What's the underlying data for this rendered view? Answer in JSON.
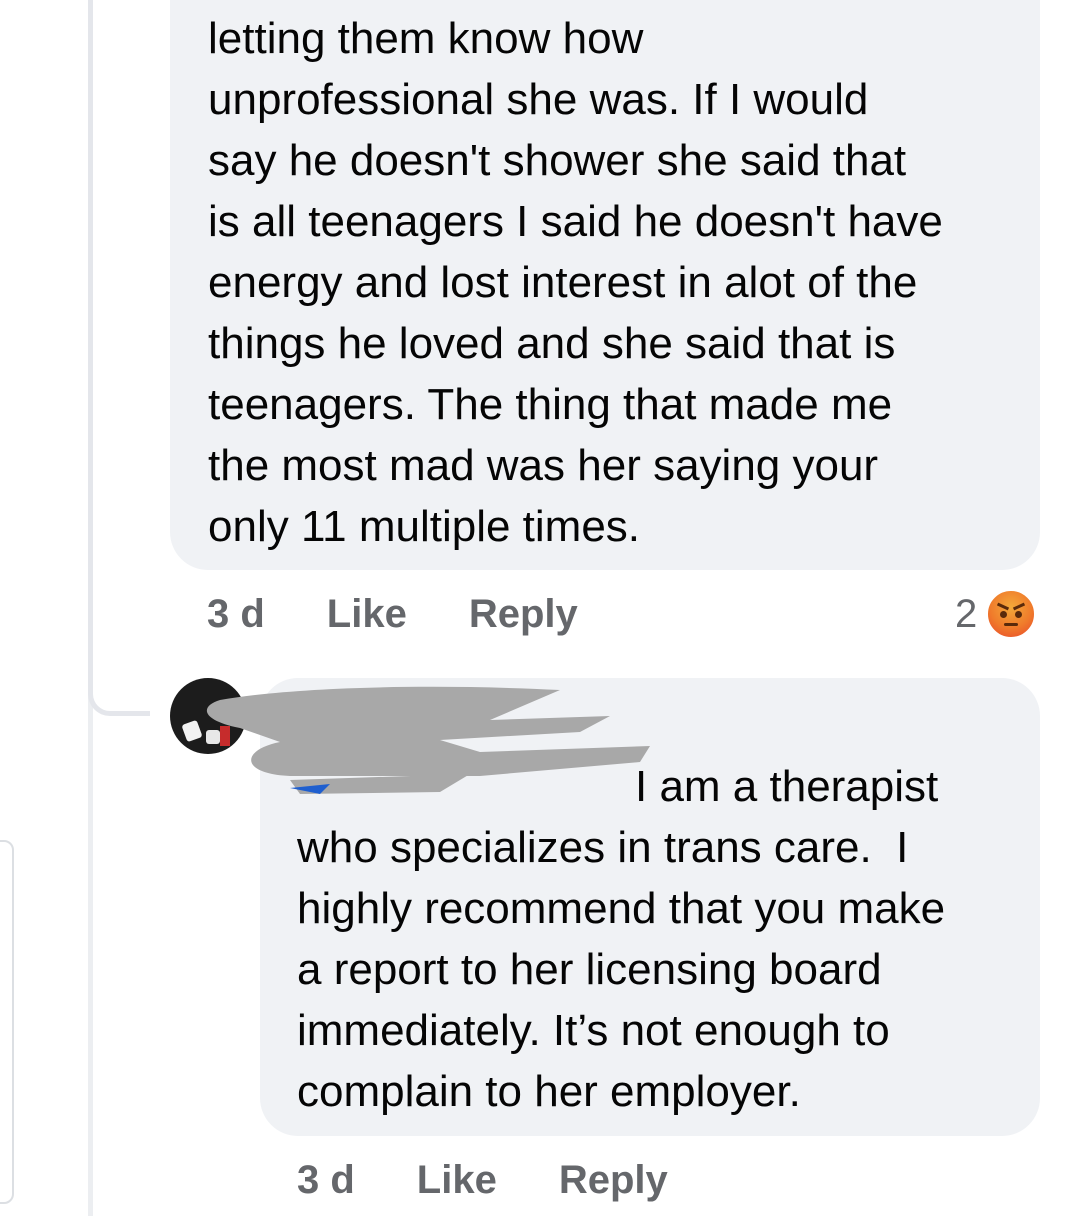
{
  "comments": [
    {
      "text": "letting them know how\nunprofessional she was. If I would\nsay he doesn't shower she said that\nis all teenagers I said he doesn't have\nenergy and lost interest in alot of the\nthings he loved and she said that is\nteenagers. The thing that made me\nthe most mad was her saying your\nonly 11 multiple times.",
      "time": "3 d",
      "like_label": "Like",
      "reply_label": "Reply",
      "reaction_count": "2",
      "reaction_icon": "angry-icon"
    },
    {
      "text": "I am a therapist\nwho specializes in trans care.  I\nhighly recommend that you make\na report to her licensing board\nimmediately. It’s not enough to\ncomplain to her employer.",
      "time": "3 d",
      "like_label": "Like",
      "reply_label": "Reply"
    }
  ],
  "colors": {
    "bubble": "#f0f2f5",
    "meta_text": "#65676b",
    "redaction": "#a8a8a8"
  }
}
